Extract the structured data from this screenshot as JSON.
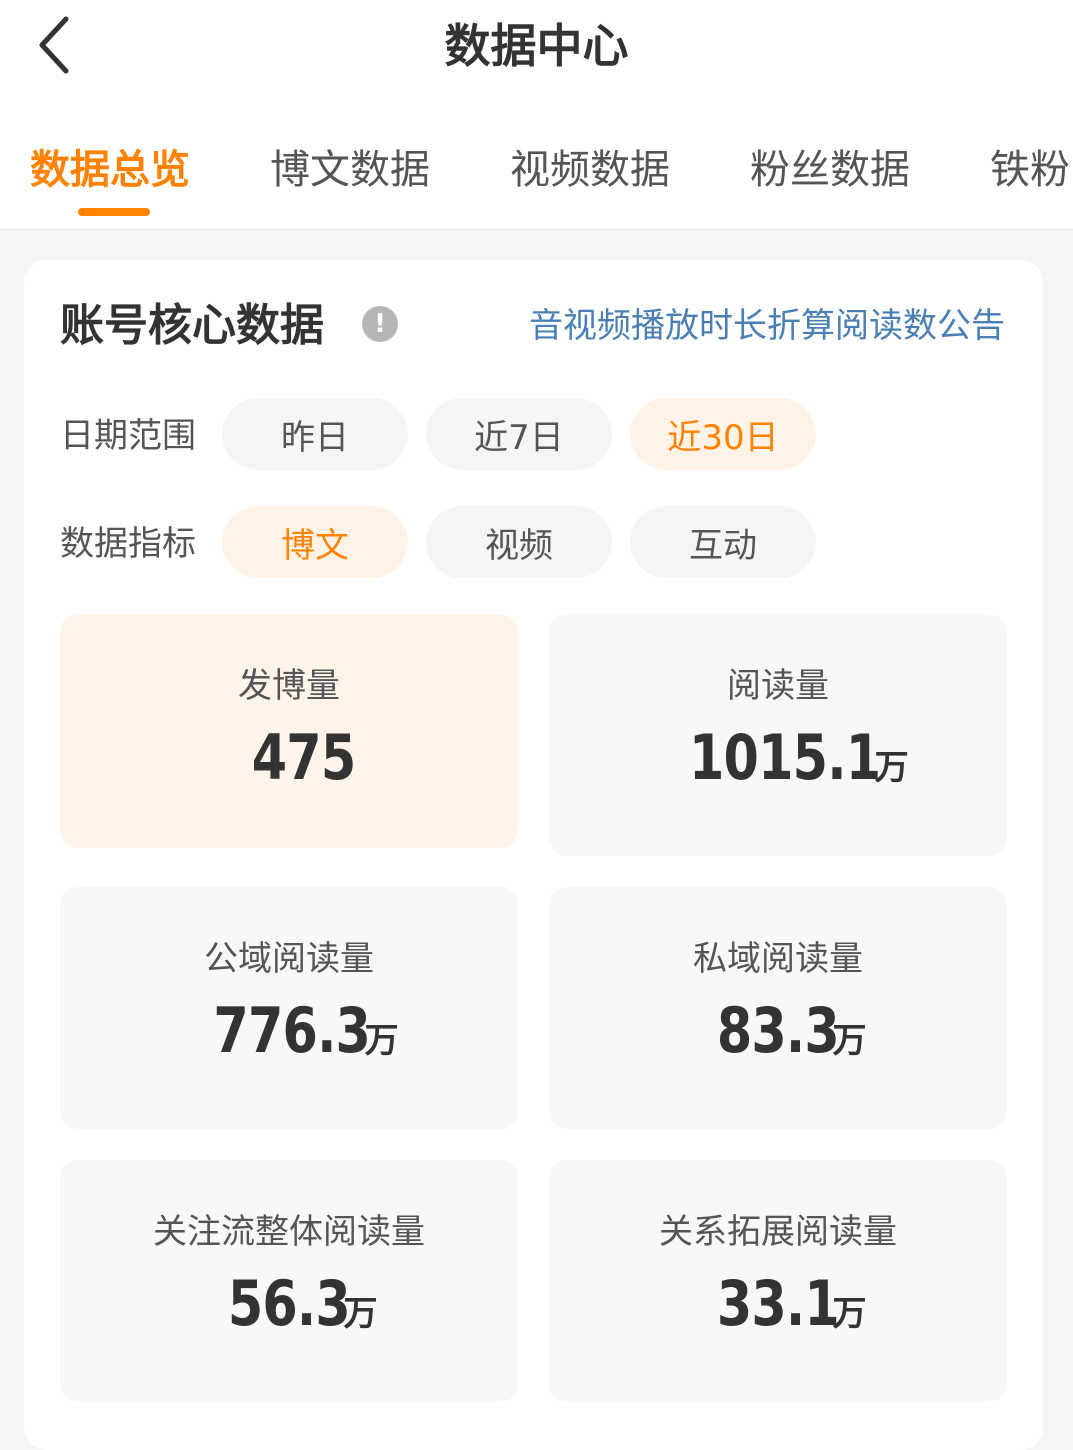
{
  "header": {
    "title": "数据中心",
    "back_icon": "chevron-left-icon"
  },
  "tabs": [
    {
      "label": "数据总览",
      "active": true
    },
    {
      "label": "博文数据",
      "active": false
    },
    {
      "label": "视频数据",
      "active": false
    },
    {
      "label": "粉丝数据",
      "active": false
    },
    {
      "label": "铁粉",
      "active": false
    }
  ],
  "card": {
    "title": "账号核心数据",
    "info_icon": "exclamation-icon",
    "notice_link": "音视频播放时长折算阅读数公告",
    "date_range": {
      "label": "日期范围",
      "options": [
        "昨日",
        "近7日",
        "近30日"
      ],
      "selected": "近30日"
    },
    "metric_type": {
      "label": "数据指标",
      "options": [
        "博文",
        "视频",
        "互动"
      ],
      "selected": "博文"
    },
    "stats": [
      {
        "label": "发博量",
        "value": "475",
        "unit": "",
        "selected": true
      },
      {
        "label": "阅读量",
        "value": "1015.1",
        "unit": "万",
        "selected": false
      },
      {
        "label": "公域阅读量",
        "value": "776.3",
        "unit": "万",
        "selected": false
      },
      {
        "label": "私域阅读量",
        "value": "83.3",
        "unit": "万",
        "selected": false
      },
      {
        "label": "关注流整体阅读量",
        "value": "56.3",
        "unit": "万",
        "selected": false
      },
      {
        "label": "关系拓展阅读量",
        "value": "33.1",
        "unit": "万",
        "selected": false
      }
    ]
  },
  "colors": {
    "accent": "#ff8200",
    "link": "#4a7fb5",
    "active_bg": "#fff2e6"
  }
}
